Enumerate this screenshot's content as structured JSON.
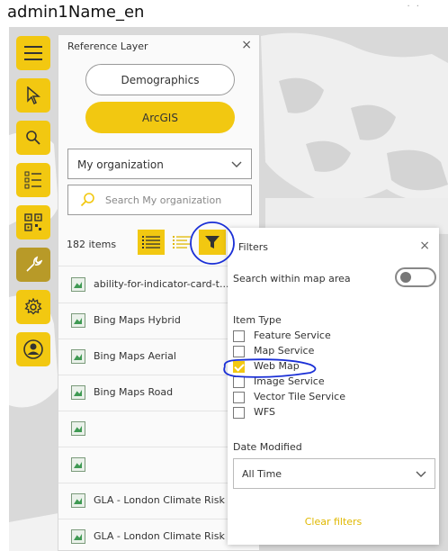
{
  "window": {
    "title": "admin1Name_en"
  },
  "toolbar": {
    "tools": [
      {
        "name": "menu"
      },
      {
        "name": "select"
      },
      {
        "name": "search"
      },
      {
        "name": "legend"
      },
      {
        "name": "qr"
      },
      {
        "name": "wrench",
        "active": true
      },
      {
        "name": "settings"
      },
      {
        "name": "user"
      }
    ]
  },
  "reference_panel": {
    "header": "Reference Layer",
    "close": "×",
    "demographics_label": "Demographics",
    "arcgis_label": "ArcGIS",
    "source_select": "My organization",
    "search_placeholder": "Search My organization",
    "item_count": "182 items",
    "items": [
      "ability-for-indicator-card-t...",
      "Bing Maps Hybrid",
      "Bing Maps Aerial",
      "Bing Maps Road",
      "",
      "",
      "GLA - London Climate Risk ...",
      "GLA - London Climate Risk ..."
    ]
  },
  "filters": {
    "title": "Filters",
    "close": "×",
    "search_within_label": "Search within map area",
    "search_within_on": false,
    "item_type_label": "Item Type",
    "item_types": [
      {
        "label": "Feature Service",
        "checked": false
      },
      {
        "label": "Map Service",
        "checked": false
      },
      {
        "label": "Web Map",
        "checked": true
      },
      {
        "label": "Image Service",
        "checked": false
      },
      {
        "label": "Vector Tile Service",
        "checked": false
      },
      {
        "label": "WFS",
        "checked": false
      }
    ],
    "date_modified_label": "Date Modified",
    "date_value": "All Time",
    "clear_label": "Clear filters"
  },
  "colors": {
    "accent": "#f2c811",
    "annotation": "#1a2fd6",
    "map": "#dcdcdc"
  }
}
